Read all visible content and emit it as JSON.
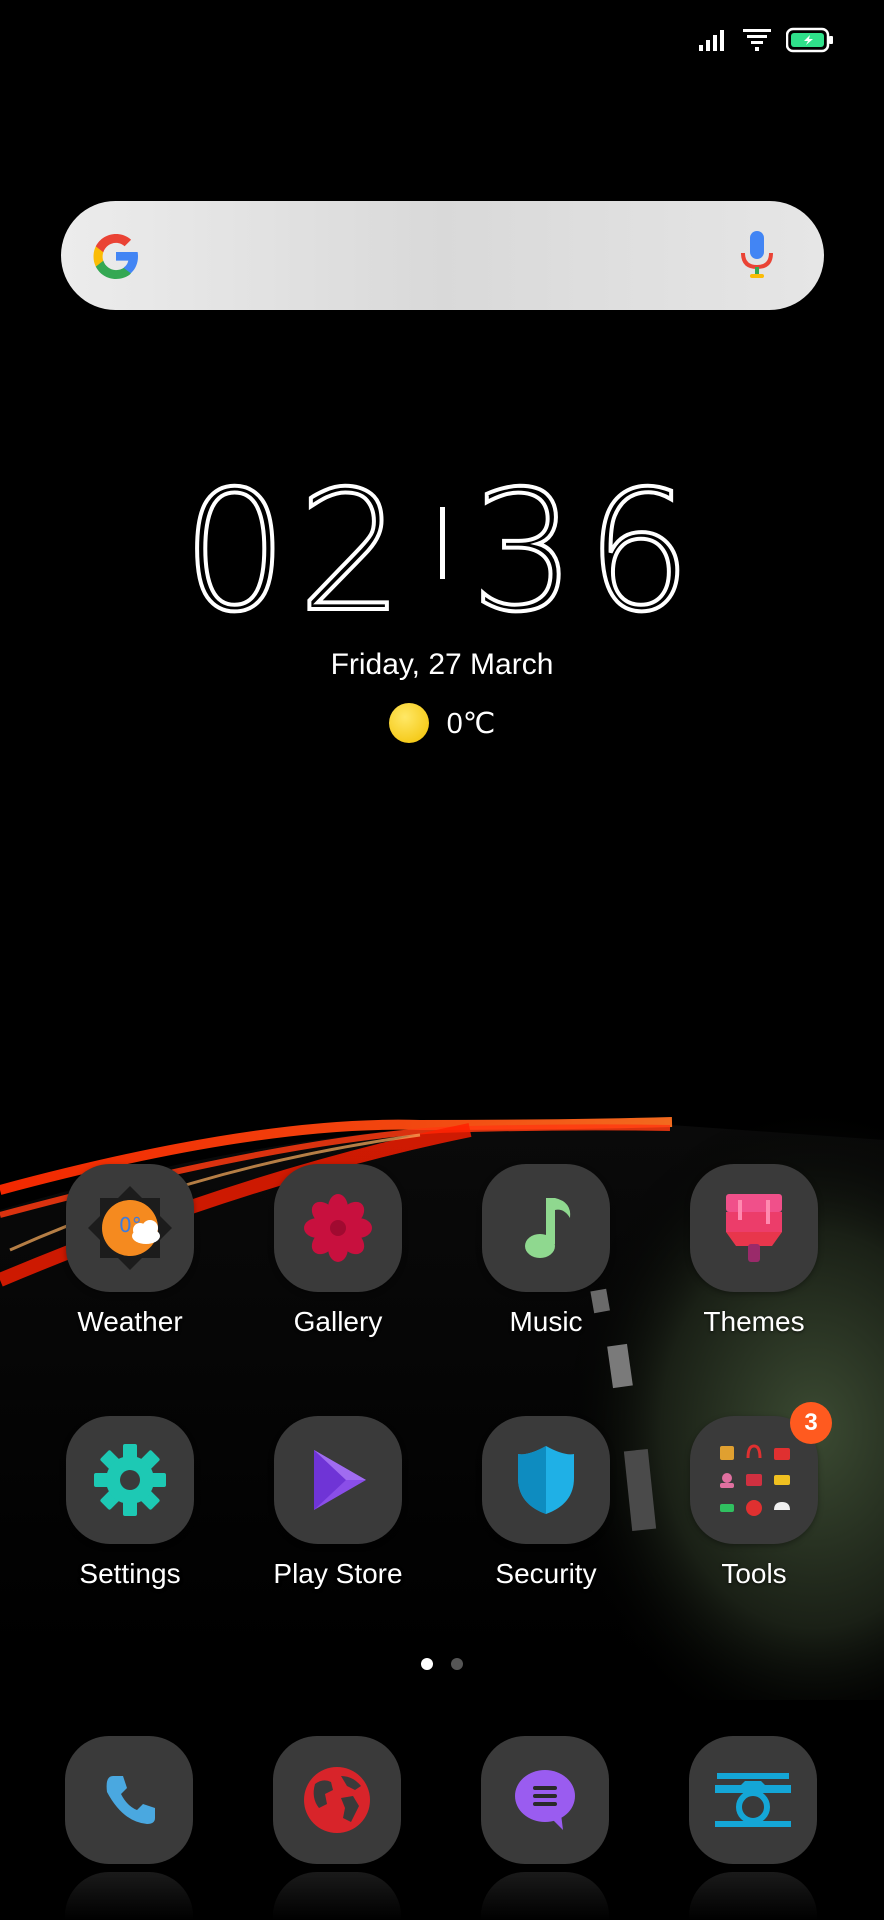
{
  "status_bar": {
    "icons": [
      "signal-icon",
      "wifi-icon",
      "battery-charging-icon"
    ],
    "battery_color": "#2fe08a"
  },
  "search": {
    "logo": "google-logo",
    "mic": "mic-icon"
  },
  "clock": {
    "hours": "02",
    "minutes": "36",
    "date": "Friday, 27 March"
  },
  "weather_widget": {
    "icon": "sun-icon",
    "temperature": "0℃"
  },
  "apps": [
    {
      "label": "Weather",
      "icon": "weather-icon"
    },
    {
      "label": "Gallery",
      "icon": "gallery-icon"
    },
    {
      "label": "Music",
      "icon": "music-note-icon"
    },
    {
      "label": "Themes",
      "icon": "themes-brush-icon"
    },
    {
      "label": "Settings",
      "icon": "gear-icon"
    },
    {
      "label": "Play Store",
      "icon": "play-store-icon"
    },
    {
      "label": "Security",
      "icon": "shield-icon"
    },
    {
      "label": "Tools",
      "icon": "tools-folder-icon",
      "badge": "3"
    }
  ],
  "weather_app_icon_text": "0°",
  "pager": {
    "pages": 2,
    "active": 0
  },
  "dock": [
    {
      "icon": "phone-icon"
    },
    {
      "icon": "browser-globe-icon"
    },
    {
      "icon": "messages-icon"
    },
    {
      "icon": "camera-icon"
    }
  ],
  "colors": {
    "tile": "#3a3a3a",
    "badge": "#ff5a1f",
    "settings_teal": "#1dc9b4",
    "play_purple": "#8a4ee8",
    "security_blue": "#1fb0e6",
    "gallery_red": "#c8103e",
    "music_green": "#8fd88f",
    "phone_blue": "#4aa8e0",
    "browser_red": "#d8242a",
    "messages_purple": "#9a5cf0",
    "camera_cyan": "#14a6d6"
  }
}
